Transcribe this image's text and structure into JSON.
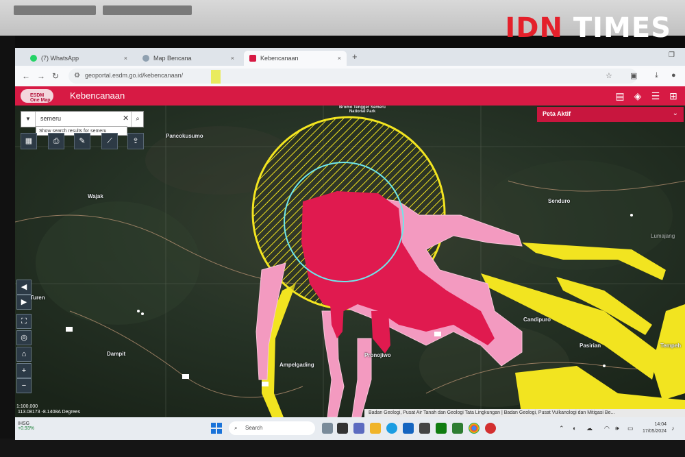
{
  "watermark": {
    "part1": "IDN",
    "part2": "TIMES"
  },
  "browser": {
    "tabs": [
      {
        "label": "(7) WhatsApp",
        "close": "×"
      },
      {
        "label": "Map Bencana",
        "close": "×"
      },
      {
        "label": "Kebencanaan",
        "close": "×"
      }
    ],
    "new_tab": "+",
    "url": "geoportal.esdm.go.id/kebencanaan/"
  },
  "app": {
    "logo_text": "ESDM One Map",
    "title": "Kebencanaan",
    "search_value": "semeru",
    "search_suggestion": "Show search results for semeru",
    "active_panel_title": "Peta Aktif"
  },
  "map": {
    "places": {
      "pancokusumo": "Pancokusumo",
      "wajak": "Wajak",
      "turen": "Turen",
      "dampit": "Dampit",
      "ampelgading": "Ampelgading",
      "pronojiwo": "Pronojiwo",
      "candipuro": "Candipuro",
      "senduro": "Senduro",
      "pasirian": "Pasirian",
      "tempeh": "Tempeh",
      "bromo": "Bromo Tengger Semeru National Park",
      "lumajang": "Lumajang"
    },
    "scale": "1:100,000",
    "coords": "113.08173 -8.1408A Degrees",
    "attribution": "Badan Geologi, Pusat Air Tanah dan Geologi Tata Lingkungan | Badan Geologi, Pusat Vulkanologi dan Mitigasi Be..."
  },
  "taskbar": {
    "weather_name": "IHSG",
    "weather_value": "+0.93%",
    "search_label": "Search",
    "time": "14:04",
    "date": "17/05/2024"
  },
  "colors": {
    "header_red": "#d71a44",
    "hazard_high": "#e01a4f",
    "hazard_mid": "#f39ac0",
    "hazard_low": "#f2e420",
    "radius_ring": "#6fe6ea"
  }
}
